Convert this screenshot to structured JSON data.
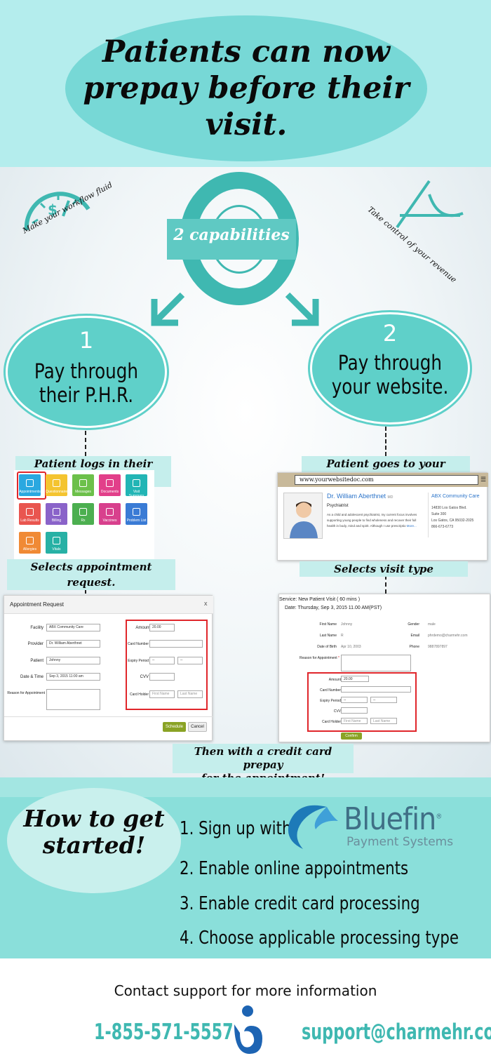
{
  "header": {
    "title": "Patients can now prepay before their visit."
  },
  "capabilities": {
    "badge": "2 capabilities",
    "left_tagline": "Make your workflow fluid",
    "right_tagline": "Take control of your revenue",
    "option1": {
      "number": "1",
      "title": "Pay through their P.H.R."
    },
    "option2": {
      "number": "2",
      "title": "Pay through your website."
    }
  },
  "phr": {
    "login_label": "Patient logs in their P.H.R.",
    "select_label": "Selects appointment request.",
    "tiles": [
      {
        "label": "Appointments",
        "color": "#2aa8e0"
      },
      {
        "label": "Questionnaires",
        "color": "#f4c430"
      },
      {
        "label": "Messages",
        "color": "#6cc04a"
      },
      {
        "label": "Documents",
        "color": "#e23f8a"
      },
      {
        "label": "Visit Summary",
        "color": "#22b5b5"
      },
      {
        "label": "Lab Results",
        "color": "#e9554f"
      },
      {
        "label": "Billing",
        "color": "#8a63c9"
      },
      {
        "label": "Rx",
        "color": "#4caf50"
      },
      {
        "label": "Vaccines",
        "color": "#d8408d"
      },
      {
        "label": "Problem List",
        "color": "#3a7bd5"
      },
      {
        "label": "Allergies",
        "color": "#f08a35"
      },
      {
        "label": "Vitals",
        "color": "#27b1a5"
      }
    ]
  },
  "appointment_modal": {
    "title": "Appointment Request",
    "close": "x",
    "fields": [
      {
        "label": "Facility",
        "value": "ABX Community Care"
      },
      {
        "label": "Provider",
        "value": "Dr. William Aberthnet"
      },
      {
        "label": "Patient",
        "value": "Johnny"
      },
      {
        "label": "Date & Time",
        "value": "Sep 3, 2015  11:00 am"
      },
      {
        "label": "Reason for Appointment",
        "value": ""
      }
    ],
    "card": {
      "amount_label": "Amount",
      "amount_value": "20.00",
      "number_label": "Card Number",
      "expiry_label": "Expiry Period",
      "expiry_month": "--",
      "expiry_year": "--",
      "cvv_label": "CVV",
      "holder_label": "Card Holder",
      "first_placeholder": "First Name",
      "last_placeholder": "Last Name"
    },
    "schedule_button": "Schedule",
    "cancel_button": "Cancel"
  },
  "website": {
    "goes_label": "Patient goes to your website.",
    "url": "www.yourwebsitedoc.com",
    "doctor_name": "Dr. William Aberthnet",
    "doctor_suffix": "MD",
    "specialty": "Psychiatrist",
    "bio": "As a child and adolescent psychiatrist, my current focus involves supporting young people to find wholeness and recover their full health in body, mind and spirit. Although I use prescriptio",
    "more": "More...",
    "practice": "ABX Community Care",
    "address1": "14830 Los Gatos Blvd.",
    "address2": "Suite 300",
    "address3": "Los Gatos, CA 95032-2025",
    "phone": "866-673-6773",
    "select_label": "Selects visit type"
  },
  "visit_form": {
    "service": "Service: New Patient Visit ( 60 mins )",
    "date": "Date: Thursday, Sep 3, 2015 11.00 AM(PST)",
    "first_name_label": "First Name",
    "first_name": "Johnny",
    "gender_label": "Gender",
    "gender": "male",
    "last_name_label": "Last Name",
    "last_name": "R",
    "email_label": "Email",
    "email": "phrdemo@charmehr.com",
    "dob_label": "Date of Birth",
    "dob": "Apr 10, 2003",
    "phone_label": "Phone",
    "phone": "9887897897",
    "reason_label": "Reason for Appointment",
    "amount_label": "Amount",
    "amount_value": "20.00",
    "number_label": "Card Number",
    "expiry_label": "Expiry Period",
    "expiry_month": "--",
    "expiry_year": "--",
    "cvv_label": "CVV",
    "holder_label": "Card Holder",
    "first_placeholder": "First Name",
    "last_placeholder": "Last Name",
    "confirm_button": "Confirm"
  },
  "prepay_note": {
    "line1": "Then with a credit card prepay",
    "line2": "for the appointment!"
  },
  "get_started": {
    "heading_line1": "How to get",
    "heading_line2": "started!",
    "step1": "1. Sign up with",
    "brand": "Bluefin",
    "brand_mark": "®",
    "brand_sub": "Payment Systems",
    "step2": "2. Enable online appointments",
    "step3": "3. Enable credit card processing",
    "step4": "4. Choose applicable processing type"
  },
  "footer": {
    "contact": "Contact support for more information",
    "phone": "1-855-571-5557",
    "email": "support@charmehr.com"
  },
  "colors": {
    "teal": "#3fb8b1",
    "light_teal": "#b4eded",
    "accent_red": "#e0262b"
  }
}
